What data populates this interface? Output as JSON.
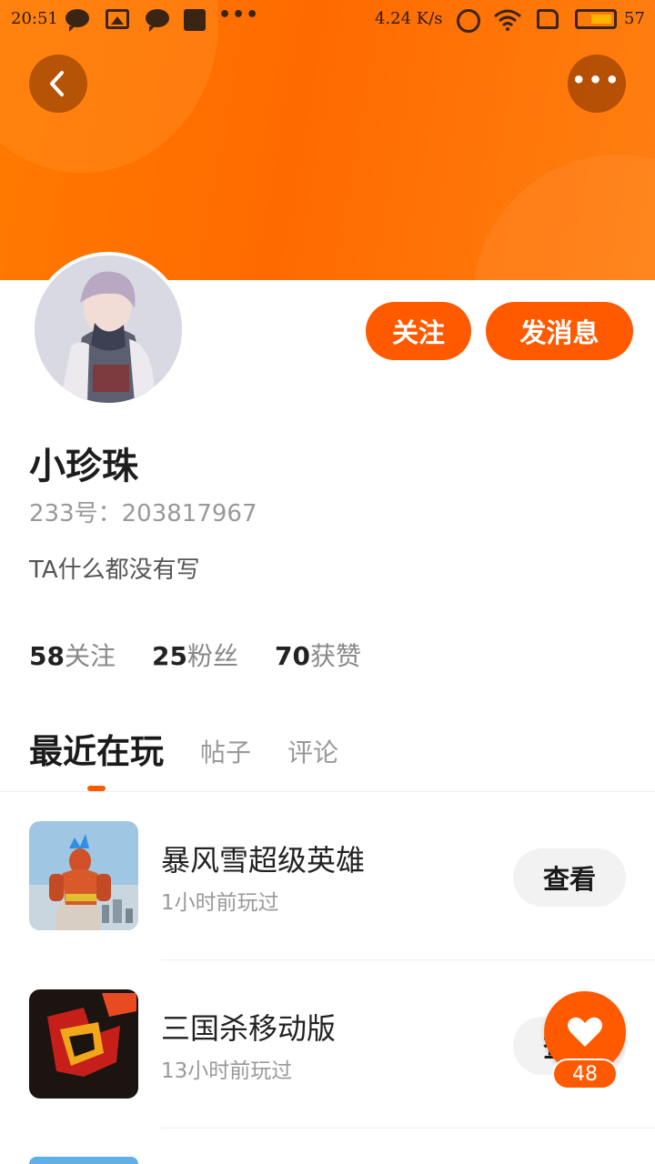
{
  "status_bar": {
    "time": "20:51",
    "net_speed": "4.24 K/s",
    "battery": "57"
  },
  "header": {
    "back_icon": "chevron-left-icon",
    "more_icon": "more-horizontal-icon",
    "accent_color": "#ff6a00"
  },
  "profile": {
    "name": "小珍珠",
    "id_label": "233号：203817967",
    "bio": "TA什么都没有写",
    "follow_label": "关注",
    "message_label": "发消息",
    "stats": [
      {
        "num": "58",
        "label": "关注"
      },
      {
        "num": "25",
        "label": "粉丝"
      },
      {
        "num": "70",
        "label": "获赞"
      }
    ]
  },
  "tabs": [
    {
      "label": "最近在玩",
      "active": true
    },
    {
      "label": "帖子",
      "active": false
    },
    {
      "label": "评论",
      "active": false
    }
  ],
  "games": [
    {
      "name": "暴风雪超级英雄",
      "played": "1小时前玩过",
      "action": "查看"
    },
    {
      "name": "三国杀移动版",
      "played": "13小时前玩过",
      "action": "查看"
    }
  ],
  "like_fab": {
    "count": "48",
    "icon": "heart-icon"
  }
}
